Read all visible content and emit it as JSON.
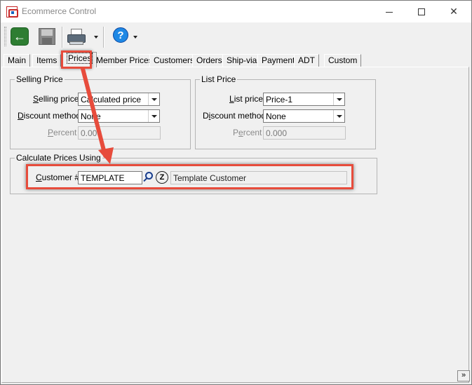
{
  "window": {
    "title": "Ecommerce Control",
    "controls": {
      "minimize": "",
      "maximize": "",
      "close": "✕"
    }
  },
  "toolbar": {
    "icons": [
      "back-arrow-icon",
      "save-disk-icon",
      "printer-icon",
      "help-pointer-icon"
    ]
  },
  "tabs": [
    {
      "label": "Main",
      "active": false
    },
    {
      "label": "Items",
      "active": false
    },
    {
      "label": "Prices",
      "active": true
    },
    {
      "label": "Member Prices",
      "active": false
    },
    {
      "label": "Customers",
      "active": false
    },
    {
      "label": "Orders",
      "active": false
    },
    {
      "label": "Ship-via",
      "active": false
    },
    {
      "label": "Payment",
      "active": false
    },
    {
      "label": "ADT",
      "active": false
    },
    {
      "label": "Custom",
      "active": false
    }
  ],
  "selling_price": {
    "legend": "Selling Price",
    "selling_price_label": "elling price",
    "selling_price_label_hotkey": "S",
    "selling_price_value": "Calculated price",
    "discount_method_label": "iscount method",
    "discount_method_label_hotkey": "D",
    "discount_method_value": "None",
    "percent_label": "ercent",
    "percent_label_hotkey": "P",
    "percent_value": "0.000"
  },
  "list_price": {
    "legend": "List Price",
    "list_price_label": "ist price",
    "list_price_label_hotkey": "L",
    "list_price_value": "Price-1",
    "discount_method_label_prefix": "D",
    "discount_method_label_hotkey": "i",
    "discount_method_label_suffix": "scount method",
    "discount_method_value": "None",
    "percent_label_prefix": "P",
    "percent_label_hotkey": "e",
    "percent_label_suffix": "rcent",
    "percent_value": "0.000"
  },
  "calculate_prices": {
    "legend": "Calculate Prices Using",
    "customer_label_hotkey": "C",
    "customer_label": "ustomer #",
    "customer_value": "TEMPLATE",
    "clear_label": "Z",
    "customer_name": "Template Customer"
  },
  "footer": {
    "expand_label": "»"
  },
  "annotation": {
    "color": "#e74c3c"
  }
}
